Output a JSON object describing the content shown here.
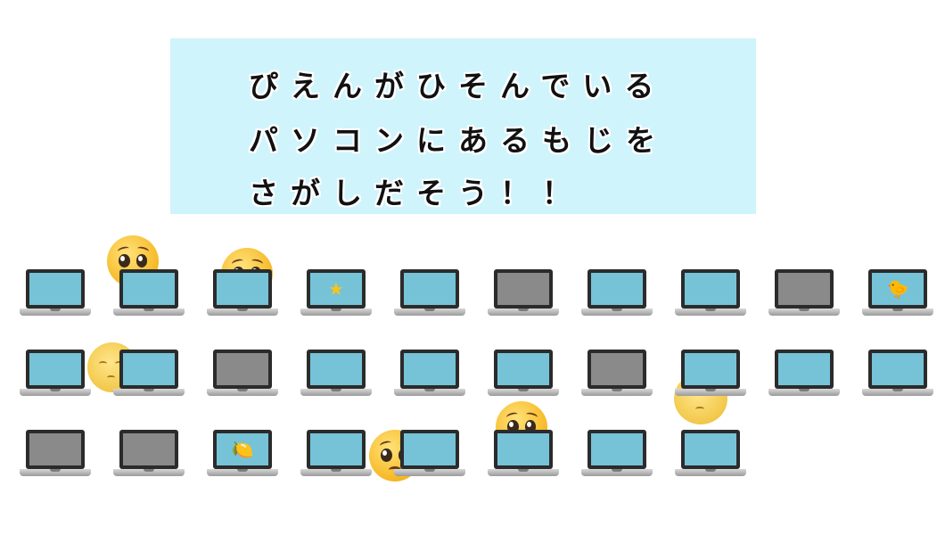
{
  "banner": {
    "lines": [
      "ぴえんがひそんでいる",
      "パソコンにあるもじを",
      "さがしだそう！！"
    ]
  },
  "laptops": {
    "row1": [
      {
        "name": "laptop-r1-c1",
        "screen": "on",
        "icon": ""
      },
      {
        "name": "laptop-r1-c2",
        "screen": "on",
        "icon": ""
      },
      {
        "name": "laptop-r1-c3",
        "screen": "on",
        "icon": ""
      },
      {
        "name": "laptop-r1-c4",
        "screen": "on",
        "icon": "star-icon"
      },
      {
        "name": "laptop-r1-c5",
        "screen": "on",
        "icon": ""
      },
      {
        "name": "laptop-r1-c6",
        "screen": "off",
        "icon": ""
      },
      {
        "name": "laptop-r1-c7",
        "screen": "on",
        "icon": ""
      },
      {
        "name": "laptop-r1-c8",
        "screen": "on",
        "icon": ""
      },
      {
        "name": "laptop-r1-c9",
        "screen": "off",
        "icon": ""
      },
      {
        "name": "laptop-r1-c10",
        "screen": "on",
        "icon": "chick-icon"
      }
    ],
    "row2": [
      {
        "name": "laptop-r2-c1",
        "screen": "on",
        "icon": ""
      },
      {
        "name": "laptop-r2-c2",
        "screen": "on",
        "icon": ""
      },
      {
        "name": "laptop-r2-c3",
        "screen": "off",
        "icon": ""
      },
      {
        "name": "laptop-r2-c4",
        "screen": "on",
        "icon": ""
      },
      {
        "name": "laptop-r2-c5",
        "screen": "on",
        "icon": ""
      },
      {
        "name": "laptop-r2-c6",
        "screen": "on",
        "icon": ""
      },
      {
        "name": "laptop-r2-c7",
        "screen": "off",
        "icon": ""
      },
      {
        "name": "laptop-r2-c8",
        "screen": "on",
        "icon": ""
      },
      {
        "name": "laptop-r2-c9",
        "screen": "on",
        "icon": ""
      },
      {
        "name": "laptop-r2-c10",
        "screen": "on",
        "icon": ""
      }
    ],
    "row3": [
      {
        "name": "laptop-r3-c1",
        "screen": "off",
        "icon": ""
      },
      {
        "name": "laptop-r3-c2",
        "screen": "off",
        "icon": ""
      },
      {
        "name": "laptop-r3-c3",
        "screen": "on",
        "icon": "lemon-icon"
      },
      {
        "name": "laptop-r3-c4",
        "screen": "on",
        "icon": ""
      },
      {
        "name": "laptop-r3-c5",
        "screen": "on",
        "icon": ""
      },
      {
        "name": "laptop-r3-c6",
        "screen": "on",
        "icon": ""
      },
      {
        "name": "laptop-r3-c7",
        "screen": "on",
        "icon": ""
      },
      {
        "name": "laptop-r3-c8",
        "screen": "on",
        "icon": ""
      }
    ]
  },
  "hidden_faces": [
    "pleading-face-icon",
    "pleading-face-icon",
    "moon-face-icon",
    "pleading-face-icon",
    "moon-face-icon",
    "pleading-face-icon"
  ],
  "colors": {
    "banner_bg": "#cff4fc",
    "screen_on": "#76c3d8",
    "screen_off": "#8a8a8a"
  }
}
